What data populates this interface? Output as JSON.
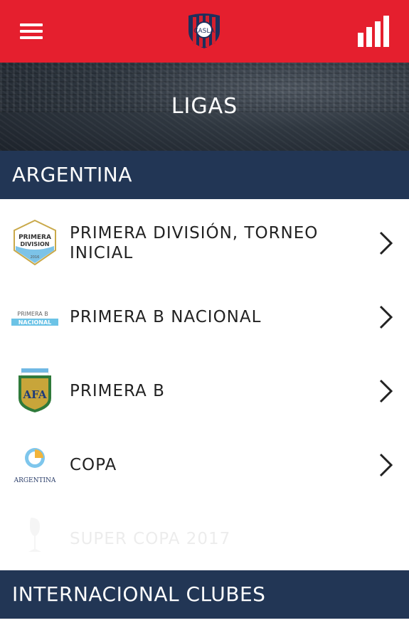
{
  "topbar": {
    "menu_icon": "hamburger-menu-icon",
    "logo": "club-crest-logo",
    "stats_icon": "bar-chart-icon",
    "bg_color": "#e51f2e"
  },
  "hero": {
    "title": "LIGAS"
  },
  "sections": [
    {
      "title": "ARGENTINA",
      "items": [
        {
          "name": "PRIMERA DIVISIÓN, TORNEO INICIAL",
          "logo": "primera-division-logo",
          "logo_text": "PRIMERA DIVISION"
        },
        {
          "name": "PRIMERA B NACIONAL",
          "logo": "primera-b-nacional-logo",
          "logo_text": "PRIMERA B NACIONAL"
        },
        {
          "name": "PRIMERA B",
          "logo": "afa-shield-logo",
          "logo_text": "AFA"
        },
        {
          "name": "COPA",
          "logo": "copa-argentina-logo",
          "logo_text": "ARGENTINA"
        },
        {
          "name": "SUPER COPA 2017",
          "logo": "supercopa-trophy-logo",
          "faded": true
        }
      ]
    },
    {
      "title": "INTERNACIONAL CLUBES"
    }
  ],
  "colors": {
    "header_navy": "#223655",
    "brand_red": "#e51f2e"
  }
}
